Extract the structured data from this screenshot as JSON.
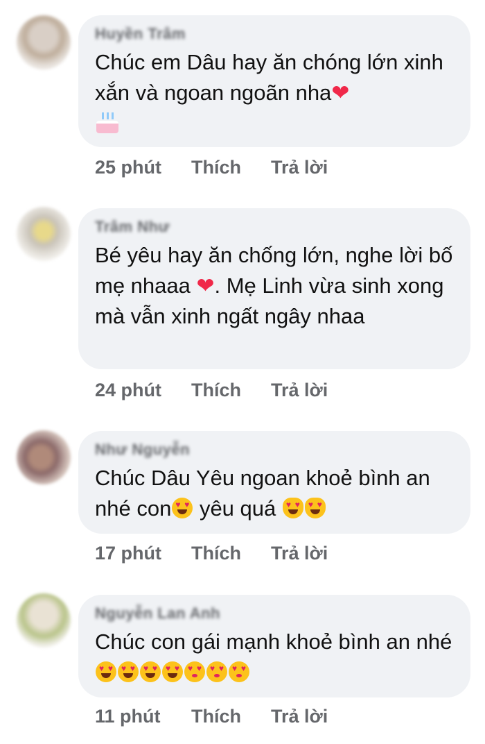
{
  "comments": [
    {
      "author": "Huyền Trâm",
      "text": "Chúc em Dâu hay ăn chóng lớn xinh xắn và ngoan ngoãn nha",
      "time": "25 phút",
      "like": "Thích",
      "reply": "Trả lời",
      "emojis": [
        "heart",
        "birthday-cake"
      ]
    },
    {
      "author": "Trâm Như",
      "text_a": "Bé yêu hay ăn chống lớn, nghe lời bố mẹ nhaaa",
      "text_b": ". Mẹ Linh vừa sinh xong mà vẫn xinh ngất ngây nhaa",
      "time": "24 phút",
      "like": "Thích",
      "reply": "Trả lời",
      "emojis": [
        "heart"
      ]
    },
    {
      "author": "Như Nguyễn",
      "text_a": "Chúc Dâu Yêu ngoan khoẻ bình an nhé con",
      "text_b": " yêu quá ",
      "time": "17 phút",
      "like": "Thích",
      "reply": "Trả lời",
      "emojis": [
        "heart-eyes",
        "heart-eyes-cat",
        "heart-eyes-cat"
      ]
    },
    {
      "author": "Nguyễn Lan Anh",
      "text": "Chúc con gái mạnh khoẻ bình an nhé ",
      "time": "11 phút",
      "like": "Thích",
      "reply": "Trả lời",
      "emojis": [
        "heart-eyes",
        "heart-eyes",
        "heart-eyes",
        "heart-eyes",
        "kissing-heart",
        "kissing-heart",
        "kissing-heart"
      ]
    }
  ],
  "colors": {
    "bubble": "#f0f2f5",
    "meta": "#65676b",
    "heart": "#f02849"
  }
}
